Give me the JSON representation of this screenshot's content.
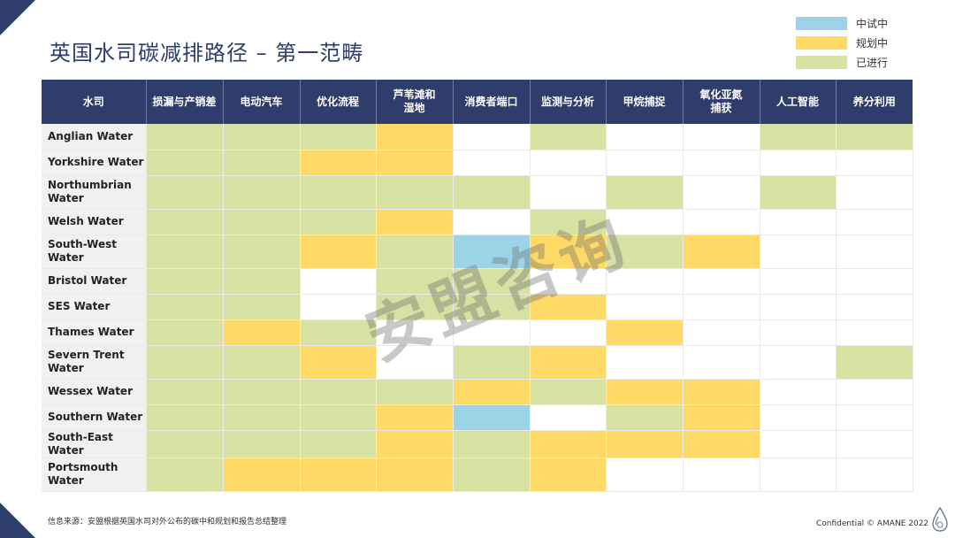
{
  "title": "英国水司碳减排路径 – 第一范畴",
  "legend": [
    {
      "label": "中试中",
      "color": "#9dd3e6"
    },
    {
      "label": "规划中",
      "color": "#fed966"
    },
    {
      "label": "已进行",
      "color": "#d6e1a2"
    }
  ],
  "table": {
    "headers": [
      "水司",
      "损漏与产销差",
      "电动汽车",
      "优化流程",
      "芦苇滩和\n湿地",
      "消费者端口",
      "监测与分析",
      "甲烷捕捉",
      "氧化亚氮\n捕获",
      "人工智能",
      "养分利用"
    ],
    "rows": [
      {
        "name": "Anglian Water",
        "cells": [
          "done",
          "done",
          "done",
          "plan",
          "none",
          "done",
          "none",
          "none",
          "done",
          "done"
        ]
      },
      {
        "name": "Yorkshire Water",
        "cells": [
          "done",
          "done",
          "plan",
          "plan",
          "none",
          "none",
          "none",
          "none",
          "none",
          "none"
        ]
      },
      {
        "name": "Northumbrian\nWater",
        "cells": [
          "done",
          "done",
          "done",
          "done",
          "done",
          "none",
          "done",
          "none",
          "done",
          "none"
        ]
      },
      {
        "name": "Welsh Water",
        "cells": [
          "done",
          "done",
          "done",
          "plan",
          "none",
          "done",
          "none",
          "none",
          "none",
          "none"
        ]
      },
      {
        "name": "South-West\nWater",
        "cells": [
          "done",
          "done",
          "plan",
          "done",
          "pilot",
          "plan",
          "done",
          "plan",
          "none",
          "none"
        ]
      },
      {
        "name": "Bristol Water",
        "cells": [
          "done",
          "done",
          "none",
          "done",
          "done",
          "none",
          "none",
          "none",
          "none",
          "none"
        ]
      },
      {
        "name": "SES Water",
        "cells": [
          "done",
          "done",
          "none",
          "done",
          "done",
          "plan",
          "none",
          "none",
          "none",
          "none"
        ]
      },
      {
        "name": "Thames Water",
        "cells": [
          "done",
          "plan",
          "done",
          "none",
          "none",
          "none",
          "plan",
          "none",
          "none",
          "none"
        ]
      },
      {
        "name": "Severn Trent\nWater",
        "cells": [
          "done",
          "done",
          "plan",
          "none",
          "done",
          "plan",
          "none",
          "none",
          "none",
          "done"
        ]
      },
      {
        "name": "Wessex Water",
        "cells": [
          "done",
          "done",
          "done",
          "done",
          "plan",
          "done",
          "plan",
          "plan",
          "none",
          "none"
        ]
      },
      {
        "name": "Southern Water",
        "cells": [
          "done",
          "done",
          "done",
          "plan",
          "pilot",
          "none",
          "done",
          "plan",
          "none",
          "none"
        ]
      },
      {
        "name": "South-East Water",
        "cells": [
          "done",
          "done",
          "done",
          "plan",
          "done",
          "plan",
          "plan",
          "plan",
          "none",
          "none"
        ]
      },
      {
        "name": "Portsmouth\nWater",
        "cells": [
          "done",
          "plan",
          "plan",
          "plan",
          "done",
          "plan",
          "none",
          "none",
          "none",
          "none"
        ]
      }
    ]
  },
  "watermark": "安盟咨询",
  "source": "信息来源：安盟根据英国水司对外公布的碳中和规划和报告总结整理",
  "confidential": "Confidential © AMANE 2022",
  "icons": {
    "brand": "water-drop-icon"
  }
}
